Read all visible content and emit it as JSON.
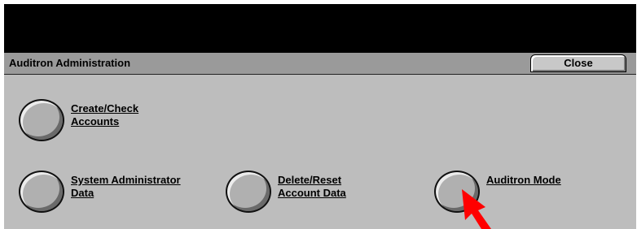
{
  "window": {
    "title": "Auditron Administration",
    "close_label": "Close"
  },
  "options": [
    {
      "line1": "Create/Check",
      "line2": "Accounts"
    },
    {
      "line1": "System Administrator",
      "line2": "Data"
    },
    {
      "line1": "Delete/Reset",
      "line2": "Account Data"
    },
    {
      "line1": "Auditron Mode",
      "line2": ""
    }
  ],
  "colors": {
    "panel_background": "#bdbdbd",
    "message_area": "#000000",
    "pointer_arrow": "#ff0000"
  },
  "annotation": {
    "icon": "red-pointer-arrow-icon",
    "points_to": "Auditron Mode"
  }
}
